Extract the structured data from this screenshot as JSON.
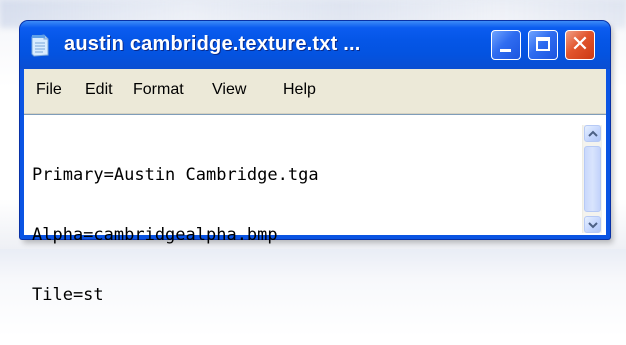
{
  "window": {
    "title": "austin cambridge.texture.txt ...",
    "icon": "notepad-icon"
  },
  "caption_buttons": {
    "minimize_icon": "minimize-icon",
    "maximize_icon": "maximize-icon",
    "close_icon": "close-icon",
    "close_glyph": "✕"
  },
  "menubar": {
    "items": [
      "File",
      "Edit",
      "Format",
      "View",
      "Help"
    ]
  },
  "editor": {
    "lines": [
      "Primary=Austin Cambridge.tga",
      "Alpha=cambridgealpha.bmp",
      "Tile=st"
    ]
  },
  "scrollbar": {
    "up_icon": "arrow-up-icon",
    "down_icon": "arrow-down-icon"
  },
  "colors": {
    "titlebar": "#0556e7",
    "close_button": "#e2552c",
    "menubar": "#ece9d8"
  }
}
